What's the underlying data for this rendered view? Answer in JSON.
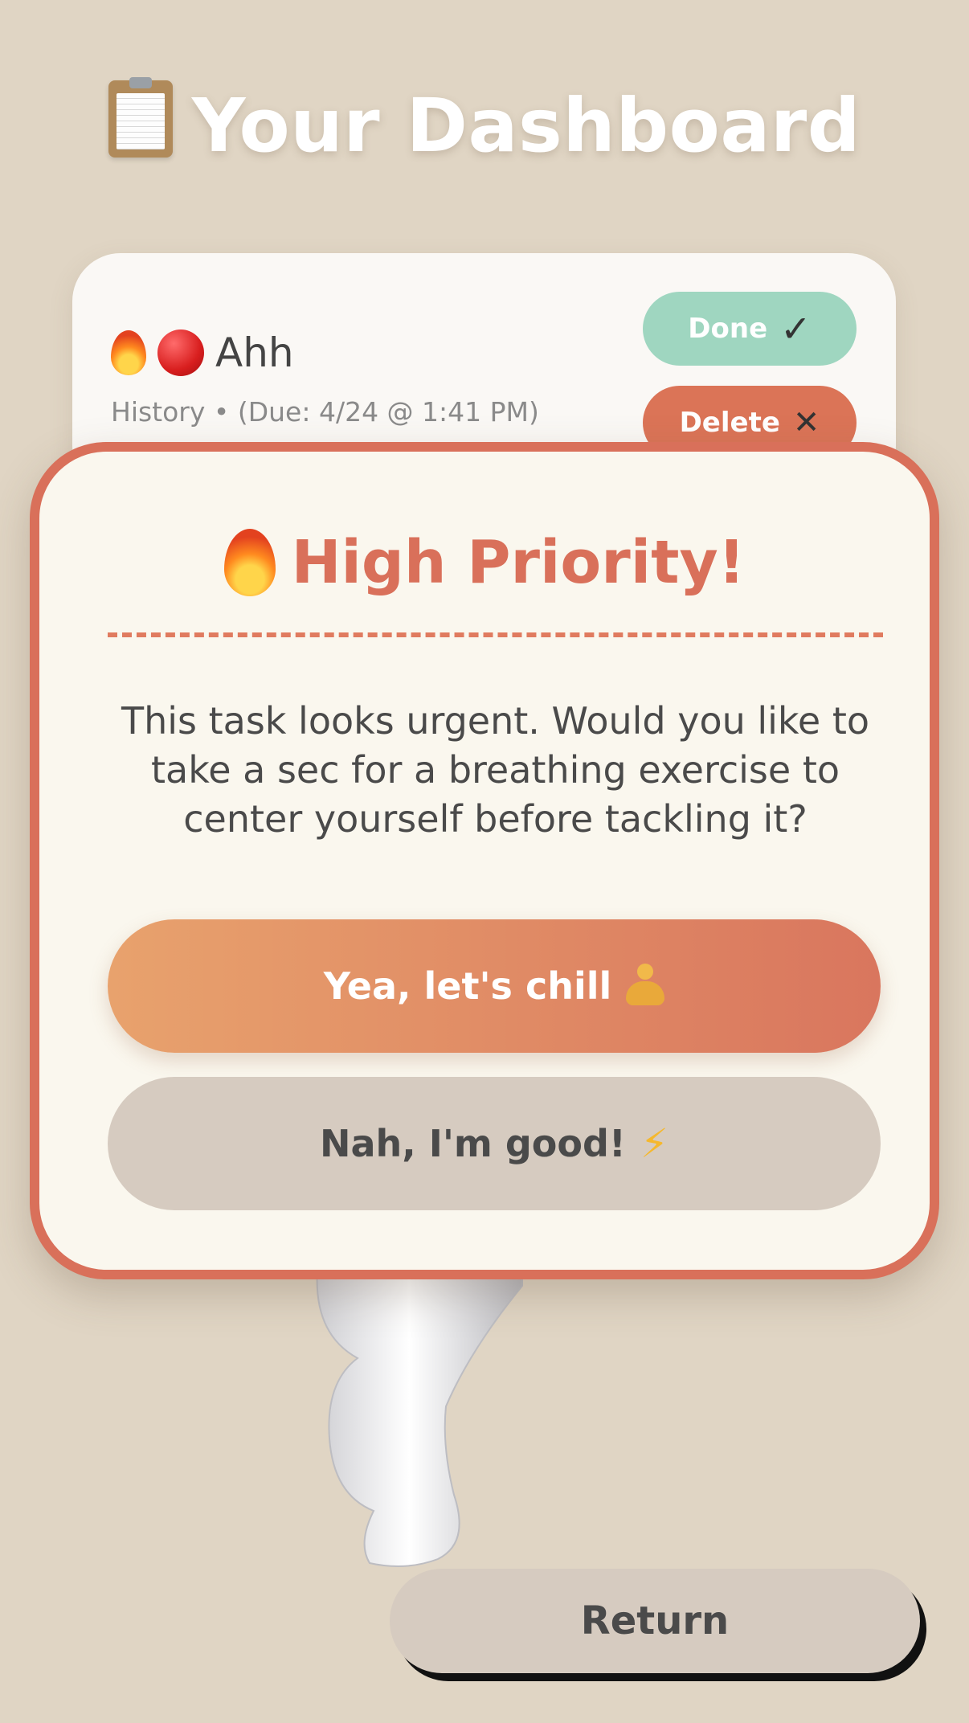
{
  "header": {
    "title": "Your Dashboard",
    "icon": "clipboard-icon"
  },
  "task": {
    "title": "Ahh",
    "meta": "History • (Due: 4/24 @ 1:41 PM)",
    "priority_icon": "flame-icon",
    "status_icon": "red-circle-icon",
    "done_label": "Done",
    "delete_label": "Delete"
  },
  "modal": {
    "title": "High Priority!",
    "message": "This task looks urgent. Would you like to take a sec for a breathing exercise to center yourself before tackling it?",
    "confirm_label": "Yea, let's chill",
    "confirm_icon": "meditation-icon",
    "dismiss_label": "Nah, I'm good!",
    "dismiss_icon": "lightning-icon"
  },
  "footer": {
    "return_label": "Return"
  },
  "colors": {
    "background": "#e0d5c4",
    "accent": "#d9705a",
    "done": "#9fd6c0",
    "delete": "#db7457",
    "neutral_button": "#d6cbc0"
  }
}
